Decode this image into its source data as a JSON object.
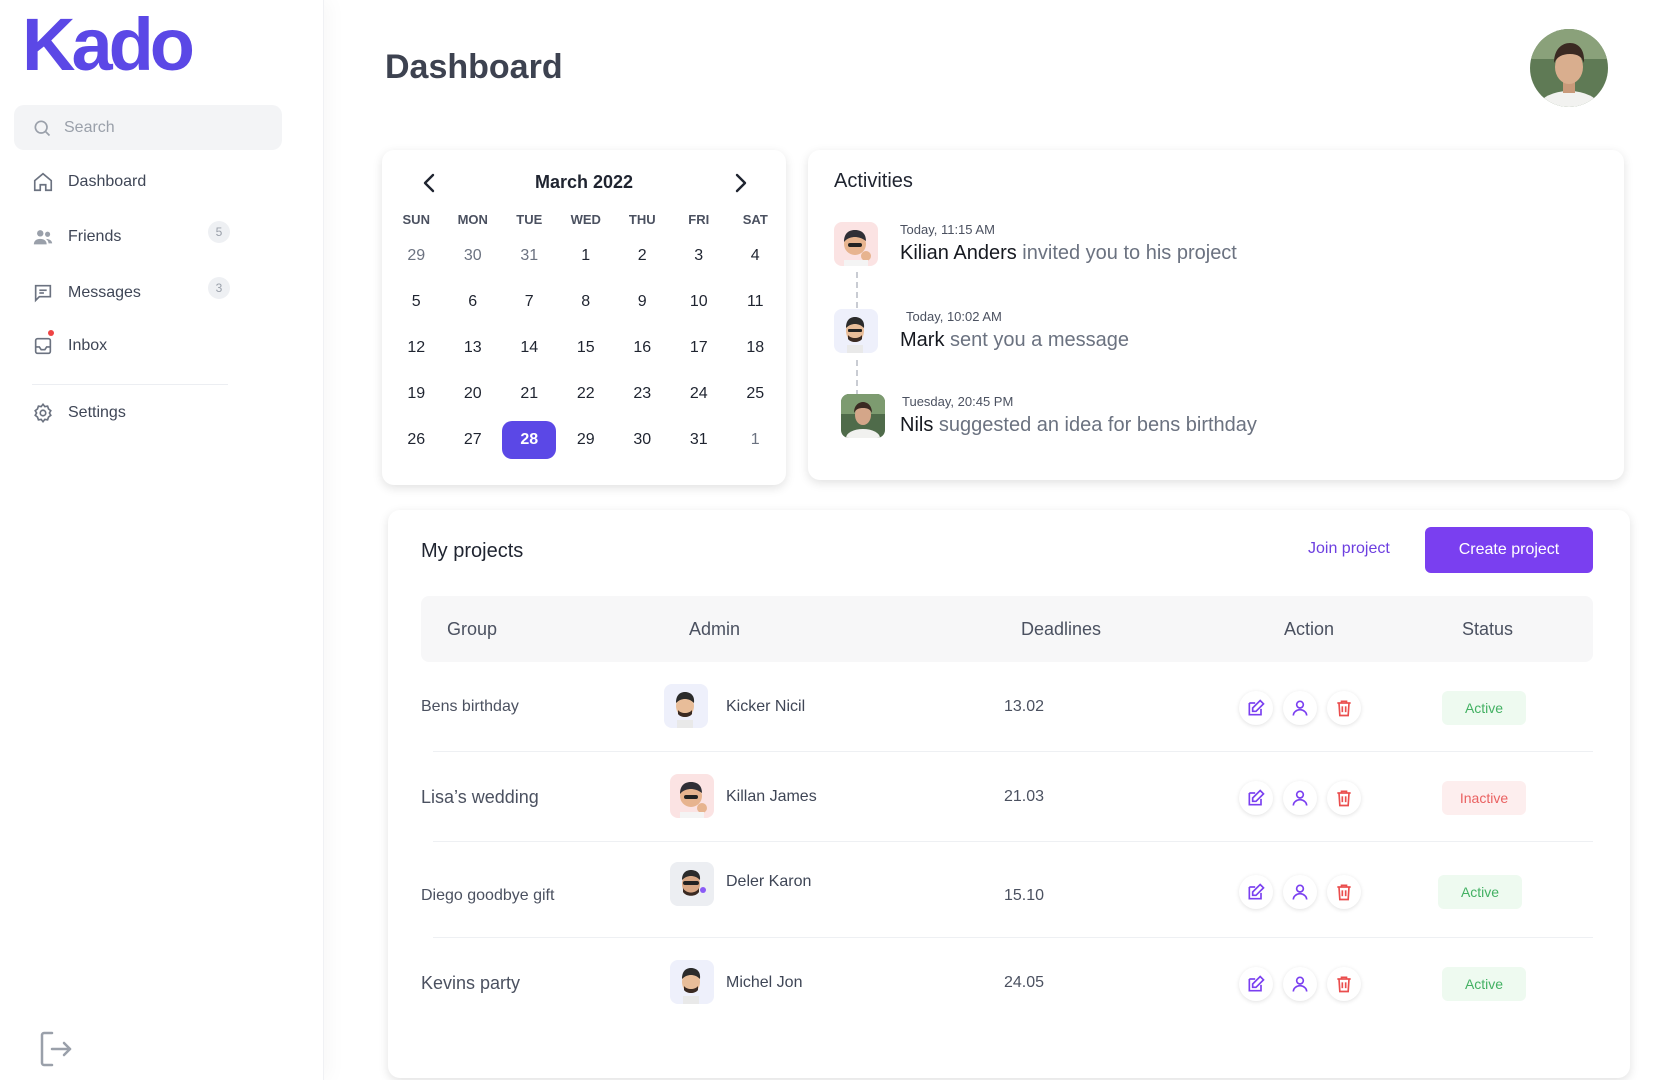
{
  "app": {
    "logo": "Kado"
  },
  "sidebar": {
    "search_placeholder": "Search",
    "items": [
      {
        "label": "Dashboard",
        "icon": "home-icon"
      },
      {
        "label": "Friends",
        "icon": "users-icon",
        "badge": "5"
      },
      {
        "label": "Messages",
        "icon": "message-icon",
        "badge": "3"
      },
      {
        "label": "Inbox",
        "icon": "inbox-icon"
      },
      {
        "label": "Settings",
        "icon": "gear-icon"
      }
    ],
    "logout_icon": "logout-icon"
  },
  "header": {
    "title": "Dashboard"
  },
  "calendar": {
    "month": "March 2022",
    "weekdays": [
      "SUN",
      "MON",
      "TUE",
      "WED",
      "THU",
      "FRI",
      "SAT"
    ],
    "weeks": [
      [
        {
          "d": "29",
          "m": true
        },
        {
          "d": "30",
          "m": true
        },
        {
          "d": "31",
          "m": true
        },
        {
          "d": "1"
        },
        {
          "d": "2"
        },
        {
          "d": "3"
        },
        {
          "d": "4"
        }
      ],
      [
        {
          "d": "5"
        },
        {
          "d": "6"
        },
        {
          "d": "7"
        },
        {
          "d": "8"
        },
        {
          "d": "9"
        },
        {
          "d": "10"
        },
        {
          "d": "11"
        }
      ],
      [
        {
          "d": "12"
        },
        {
          "d": "13"
        },
        {
          "d": "14"
        },
        {
          "d": "15"
        },
        {
          "d": "16"
        },
        {
          "d": "17"
        },
        {
          "d": "18"
        }
      ],
      [
        {
          "d": "19"
        },
        {
          "d": "20"
        },
        {
          "d": "21"
        },
        {
          "d": "22"
        },
        {
          "d": "23"
        },
        {
          "d": "24"
        },
        {
          "d": "25"
        }
      ],
      [
        {
          "d": "26"
        },
        {
          "d": "27"
        },
        {
          "d": "28",
          "s": true
        },
        {
          "d": "29"
        },
        {
          "d": "30"
        },
        {
          "d": "31"
        },
        {
          "d": "1",
          "m": true
        }
      ]
    ],
    "selected": "28"
  },
  "activities": {
    "title": "Activities",
    "items": [
      {
        "time": "Today, 11:15 AM",
        "name": "Kilian Anders",
        "text": " invited you to his project"
      },
      {
        "time": "Today, 10:02 AM",
        "name": "Mark",
        "text": " sent you a message"
      },
      {
        "time": "Tuesday, 20:45 PM",
        "name": "Nils",
        "text": " suggested an idea for bens birthday"
      }
    ]
  },
  "projects": {
    "title": "My projects",
    "join_label": "Join project",
    "create_label": "Create project",
    "columns": [
      "Group",
      "Admin",
      "Deadlines",
      "Action",
      "Status"
    ],
    "rows": [
      {
        "group": "Bens birthday",
        "admin": "Kicker Nicil",
        "deadline": "13.02",
        "status": "Active"
      },
      {
        "group": "Lisa’s wedding",
        "admin": "Killan James",
        "deadline": "21.03",
        "status": "Inactive"
      },
      {
        "group": "Diego goodbye gift",
        "admin": "Deler Karon",
        "deadline": "15.10",
        "status": "Active"
      },
      {
        "group": "Kevins party",
        "admin": "Michel Jon",
        "deadline": "24.05",
        "status": "Active"
      }
    ]
  },
  "colors": {
    "accent": "#5b48e6",
    "button": "#7a3ff0",
    "active": "#43b163",
    "inactive": "#ea6161"
  }
}
